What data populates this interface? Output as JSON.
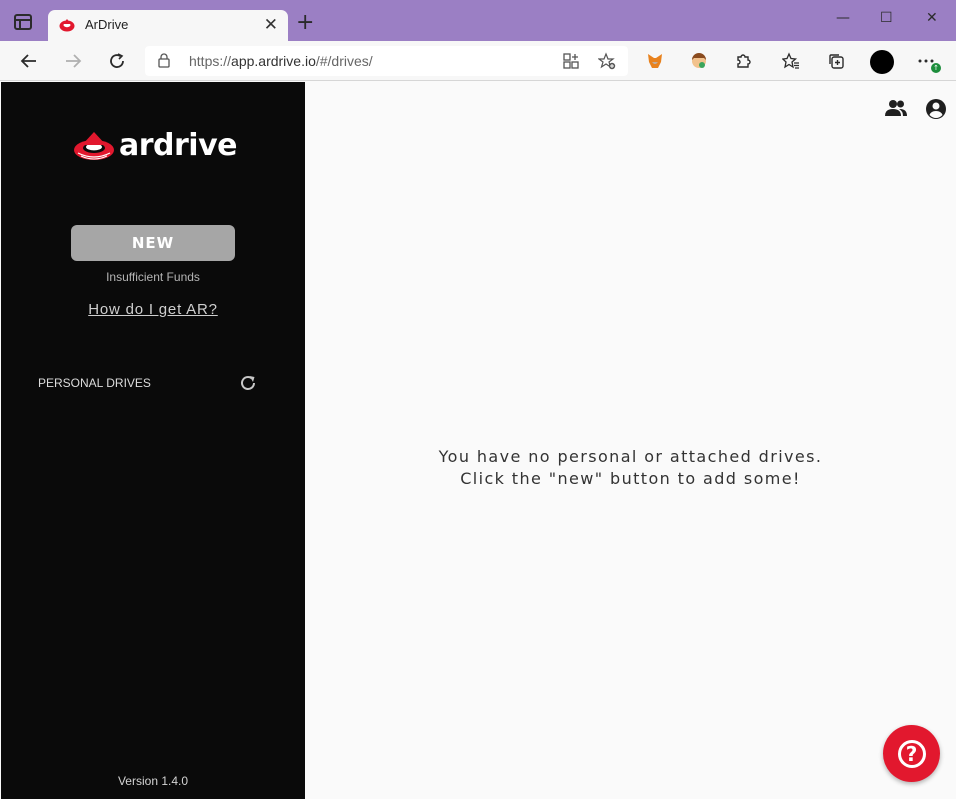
{
  "browser": {
    "tab_title": "ArDrive",
    "tab_close": "✕",
    "new_tab": "+",
    "url_prefix": "https://",
    "url_main": "app.ardrive.io",
    "url_rest": "/#/drives/",
    "minimize": "—",
    "maximize": "☐",
    "close": "✕",
    "update_badge": "↑"
  },
  "sidebar": {
    "logo_text": "ardrive",
    "new_button": "NEW",
    "insufficient_funds": "Insufficient Funds",
    "how_get_ar": "How do I get AR?",
    "personal_drives": "PERSONAL DRIVES",
    "version": "Version 1.4.0"
  },
  "main": {
    "empty_line1": "You have no personal or attached drives.",
    "empty_line2": "Click the \"new\" button to add some!",
    "help_symbol": "?"
  },
  "colors": {
    "accent_red": "#e2182e",
    "sidebar_bg": "#0a0a0a",
    "titlebar": "#9b7fc4"
  }
}
